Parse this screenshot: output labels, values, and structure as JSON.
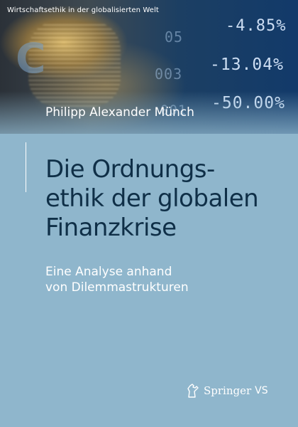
{
  "series": {
    "name": "Wirtschaftsethik in der globalisierten Welt"
  },
  "author": "Philipp Alexander Münch",
  "title": {
    "lines": [
      "Die Ordnungs-",
      "ethik der globalen",
      "Finanzkrise"
    ]
  },
  "subtitle": {
    "lines": [
      "Eine Analyse anhand",
      "von Dilemmastrukturen"
    ]
  },
  "background_figures": {
    "top": "-4.85%",
    "middle": "-13.04%",
    "bottom": "-50.00%",
    "fragment_top": "05",
    "fragment_middle": "003",
    "fragment_bottom": "001",
    "letter": "C"
  },
  "publisher": {
    "name": "Springer",
    "imprint": "VS",
    "logo_icon": "springer-horse-icon"
  },
  "colors": {
    "background": "#8fb6cc",
    "title": "#0f2f47",
    "text_light": "#ffffff"
  }
}
